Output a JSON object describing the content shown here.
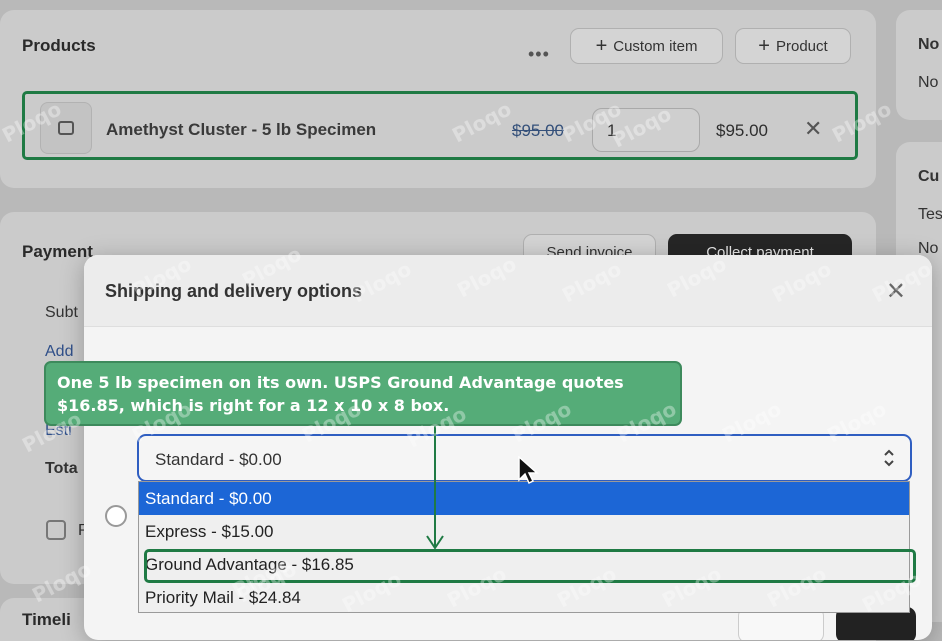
{
  "products": {
    "title": "Products",
    "more": "•••",
    "custom_item_button": "Custom item",
    "product_button": "Product",
    "line_item": {
      "name": "Amethyst Cluster - 5 lb Specimen",
      "original_price": "$95.00",
      "quantity": "1",
      "total": "$95.00",
      "remove": "✕"
    }
  },
  "payment": {
    "title": "Payment",
    "send_invoice_button": "Send invoice",
    "collect_payment_button": "Collect payment",
    "subtotal_label": "Subt",
    "add_link": "Add",
    "estimate_link": "Esti",
    "total_label": "Tota",
    "checkbox_label": "P"
  },
  "timeline": {
    "title": "Timeli"
  },
  "right_panel": {
    "notes_title": "No",
    "notes_text": "No",
    "customer_title": "Cu",
    "customer_link": "Tes",
    "customer_text": "No"
  },
  "modal": {
    "title": "Shipping and delivery options",
    "close": "✕",
    "select": {
      "value": "Standard - $0.00",
      "options": [
        "Standard - $0.00",
        "Express - $15.00",
        "Ground Advantage - $16.85",
        "Priority Mail - $24.84"
      ],
      "selected_index": 0
    }
  },
  "annotation": {
    "text": "One 5 lb specimen on its own. USPS Ground Advantage quotes $16.85, which is right for a 12 x 10 x 8 box.",
    "color": "#55ac78"
  },
  "colors": {
    "accent": "#1c66d6",
    "highlight": "#1f7a44"
  },
  "watermark": "Ploqo"
}
